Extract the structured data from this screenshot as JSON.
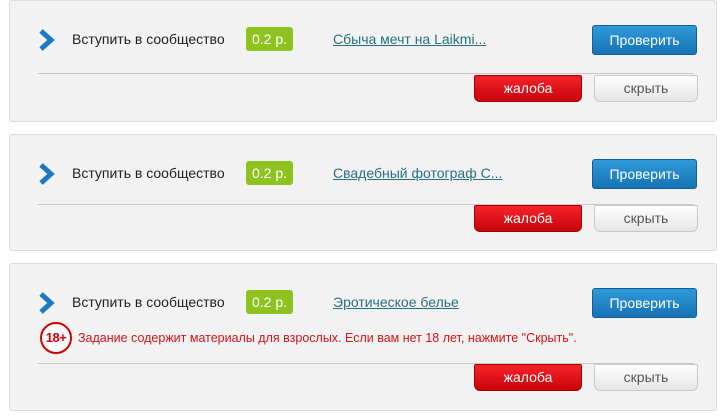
{
  "tasks": [
    {
      "action_label": "Вступить в сообщество",
      "price": "0.2 р.",
      "community_name": "Сбыча мечт на Laikmi...",
      "check_label": "Проверить",
      "complain_label": "жалоба",
      "hide_label": "скрыть"
    },
    {
      "action_label": "Вступить в сообщество",
      "price": "0.2 р.",
      "community_name": "Свадебный фотограф С...",
      "check_label": "Проверить",
      "complain_label": "жалоба",
      "hide_label": "скрыть"
    },
    {
      "action_label": "Вступить в сообщество",
      "price": "0.2 р.",
      "community_name": "Эротическое белье",
      "check_label": "Проверить",
      "complain_label": "жалоба",
      "hide_label": "скрыть",
      "adult_badge": "18+",
      "adult_warning": "Задание содержит материалы для взрослых. Если вам нет 18 лет, нажмите \"Скрыть\"."
    }
  ],
  "icons": {
    "task": "chevron-right-icon",
    "adult": "age-18-plus-icon"
  },
  "colors": {
    "price_badge": "#8dc21f",
    "check_button": "#1f86c8",
    "complain_button": "#e20f16",
    "link": "#2a6f80",
    "warning": "#d41414"
  }
}
